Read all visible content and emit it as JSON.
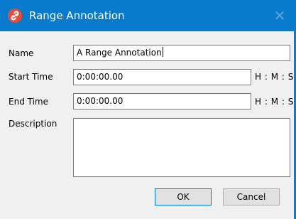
{
  "window": {
    "title": "Range Annotation",
    "icon": "link-icon",
    "close_glyph": "✕"
  },
  "form": {
    "name_label": "Name",
    "name_value": "A Range Annotation",
    "start_label": "Start Time",
    "start_value": "0:00:00.00",
    "start_unit": "H : M : S",
    "end_label": "End Time",
    "end_value": "0:00:00.00",
    "end_unit": "H : M : S",
    "description_label": "Description",
    "description_value": ""
  },
  "buttons": {
    "ok_label": "OK",
    "cancel_label": "Cancel"
  },
  "colors": {
    "title_bar": "#0a7acd",
    "icon_bg": "#e64b3c",
    "dialog_bg": "#f0f0f0"
  }
}
